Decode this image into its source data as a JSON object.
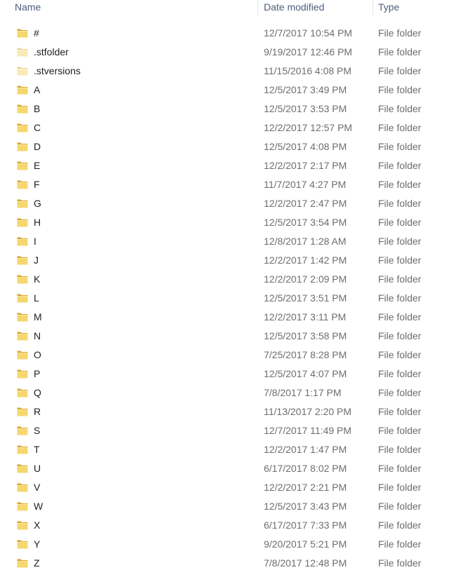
{
  "header": {
    "name": "Name",
    "date_modified": "Date modified",
    "type": "Type"
  },
  "colors": {
    "header_text": "#4c607a",
    "name_text": "#1e1e1e",
    "detail_text": "#6d6d6d",
    "folder_yellow": "#f5d76e",
    "folder_dark": "#d9a62e"
  },
  "icons": {
    "folder": "folder-icon"
  },
  "rows": [
    {
      "name": "#",
      "date": "12/7/2017 10:54 PM",
      "type": "File folder",
      "hidden": false
    },
    {
      "name": ".stfolder",
      "date": "9/19/2017 12:46 PM",
      "type": "File folder",
      "hidden": true
    },
    {
      "name": ".stversions",
      "date": "11/15/2016 4:08 PM",
      "type": "File folder",
      "hidden": true
    },
    {
      "name": "A",
      "date": "12/5/2017 3:49 PM",
      "type": "File folder",
      "hidden": false
    },
    {
      "name": "B",
      "date": "12/5/2017 3:53 PM",
      "type": "File folder",
      "hidden": false
    },
    {
      "name": "C",
      "date": "12/2/2017 12:57 PM",
      "type": "File folder",
      "hidden": false
    },
    {
      "name": "D",
      "date": "12/5/2017 4:08 PM",
      "type": "File folder",
      "hidden": false
    },
    {
      "name": "E",
      "date": "12/2/2017 2:17 PM",
      "type": "File folder",
      "hidden": false
    },
    {
      "name": "F",
      "date": "11/7/2017 4:27 PM",
      "type": "File folder",
      "hidden": false
    },
    {
      "name": "G",
      "date": "12/2/2017 2:47 PM",
      "type": "File folder",
      "hidden": false
    },
    {
      "name": "H",
      "date": "12/5/2017 3:54 PM",
      "type": "File folder",
      "hidden": false
    },
    {
      "name": "I",
      "date": "12/8/2017 1:28 AM",
      "type": "File folder",
      "hidden": false
    },
    {
      "name": "J",
      "date": "12/2/2017 1:42 PM",
      "type": "File folder",
      "hidden": false
    },
    {
      "name": "K",
      "date": "12/2/2017 2:09 PM",
      "type": "File folder",
      "hidden": false
    },
    {
      "name": "L",
      "date": "12/5/2017 3:51 PM",
      "type": "File folder",
      "hidden": false
    },
    {
      "name": "M",
      "date": "12/2/2017 3:11 PM",
      "type": "File folder",
      "hidden": false
    },
    {
      "name": "N",
      "date": "12/5/2017 3:58 PM",
      "type": "File folder",
      "hidden": false
    },
    {
      "name": "O",
      "date": "7/25/2017 8:28 PM",
      "type": "File folder",
      "hidden": false
    },
    {
      "name": "P",
      "date": "12/5/2017 4:07 PM",
      "type": "File folder",
      "hidden": false
    },
    {
      "name": "Q",
      "date": "7/8/2017 1:17 PM",
      "type": "File folder",
      "hidden": false
    },
    {
      "name": "R",
      "date": "11/13/2017 2:20 PM",
      "type": "File folder",
      "hidden": false
    },
    {
      "name": "S",
      "date": "12/7/2017 11:49 PM",
      "type": "File folder",
      "hidden": false
    },
    {
      "name": "T",
      "date": "12/2/2017 1:47 PM",
      "type": "File folder",
      "hidden": false
    },
    {
      "name": "U",
      "date": "6/17/2017 8:02 PM",
      "type": "File folder",
      "hidden": false
    },
    {
      "name": "V",
      "date": "12/2/2017 2:21 PM",
      "type": "File folder",
      "hidden": false
    },
    {
      "name": "W",
      "date": "12/5/2017 3:43 PM",
      "type": "File folder",
      "hidden": false
    },
    {
      "name": "X",
      "date": "6/17/2017 7:33 PM",
      "type": "File folder",
      "hidden": false
    },
    {
      "name": "Y",
      "date": "9/20/2017 5:21 PM",
      "type": "File folder",
      "hidden": false
    },
    {
      "name": "Z",
      "date": "7/8/2017 12:48 PM",
      "type": "File folder",
      "hidden": false
    }
  ]
}
